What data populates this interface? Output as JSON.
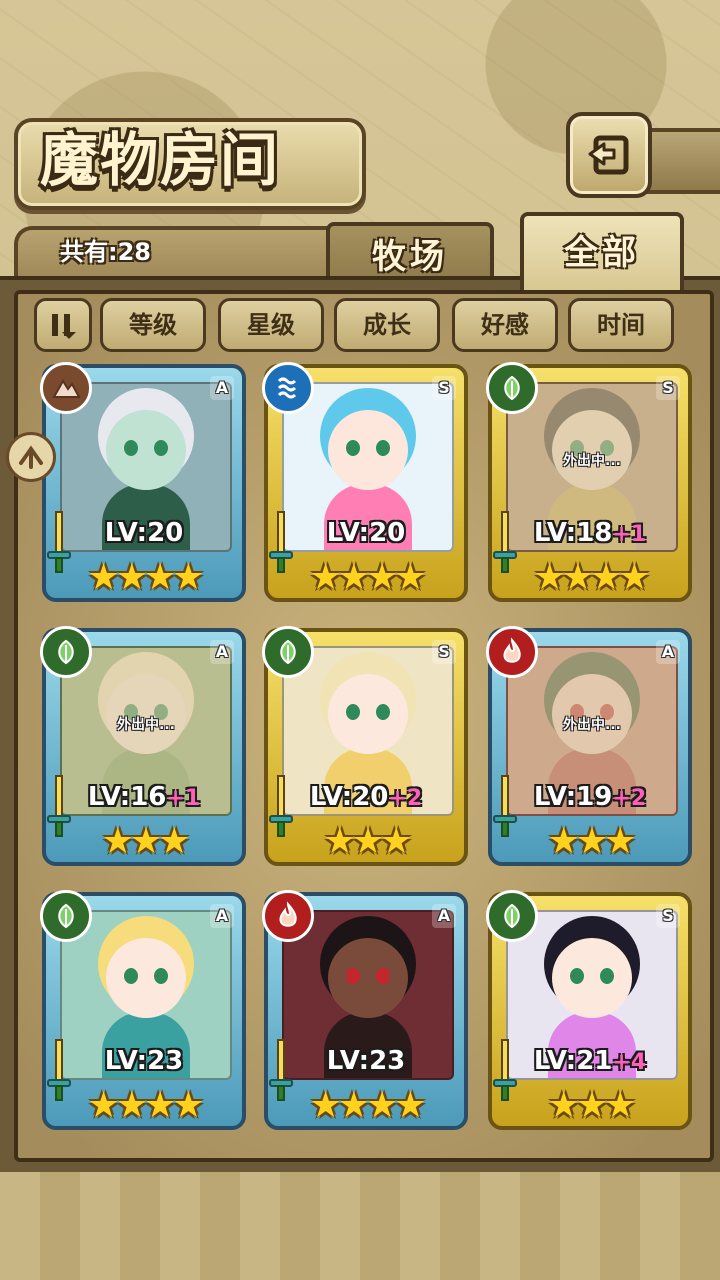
{
  "header": {
    "title": "魔物房间",
    "count_label": "共有:28"
  },
  "tabs": [
    {
      "label": "牧场",
      "active": false
    },
    {
      "label": "全部",
      "active": true
    }
  ],
  "sort": {
    "buttons": [
      "等级",
      "星级",
      "成长",
      "好感",
      "时间"
    ]
  },
  "cards": [
    {
      "rank": "A",
      "element": "earth",
      "level": "LV:20",
      "bonus": "",
      "stars": "★★★★",
      "away": "",
      "colors": {
        "hair": "#e7e9ee",
        "skin": "#bfe2d3",
        "body": "#2d5e49",
        "bg": "#8fb1b7"
      }
    },
    {
      "rank": "S",
      "element": "water",
      "level": "LV:20",
      "bonus": "",
      "stars": "★★★★",
      "away": "",
      "colors": {
        "hair": "#5fc9ec",
        "skin": "#fde6dc",
        "body": "#ff7fb5",
        "bg": "#e9f3fa"
      }
    },
    {
      "rank": "S",
      "element": "nature",
      "level": "LV:18",
      "bonus": "+1",
      "stars": "★★★★",
      "away": "外出中...",
      "colors": {
        "hair": "#3b2a2a",
        "skin": "#f3d9c7",
        "body": "#c9a24b",
        "bg": "#b58c6e"
      }
    },
    {
      "rank": "A",
      "element": "nature",
      "level": "LV:16",
      "bonus": "+1",
      "stars": "★★★",
      "away": "外出中...",
      "colors": {
        "hair": "#f7e6c9",
        "skin": "#fde8de",
        "body": "#6b9b5a",
        "bg": "#8fae7c"
      }
    },
    {
      "rank": "S",
      "element": "nature",
      "level": "LV:20",
      "bonus": "+2",
      "stars": "★★★",
      "away": "",
      "colors": {
        "hair": "#f2e3b4",
        "skin": "#fde8de",
        "body": "#f0cf6c",
        "bg": "#efe4c3"
      }
    },
    {
      "rank": "A",
      "element": "fire",
      "level": "LV:19",
      "bonus": "+2",
      "stars": "★★★",
      "away": "外出中...",
      "colors": {
        "hair": "#3c4a30",
        "skin": "#f5c9c0",
        "body": "#b23a3a",
        "bg": "#c47a6e"
      }
    },
    {
      "rank": "A",
      "element": "nature",
      "level": "LV:23",
      "bonus": "",
      "stars": "★★★★",
      "away": "",
      "colors": {
        "hair": "#f6dc7a",
        "skin": "#fde8de",
        "body": "#3aa0a0",
        "bg": "#9fd1c3"
      }
    },
    {
      "rank": "A",
      "element": "fire",
      "level": "LV:23",
      "bonus": "",
      "stars": "★★★★",
      "away": "",
      "colors": {
        "hair": "#1c1416",
        "skin": "#7a4a3a",
        "body": "#2a1a1a",
        "bg": "#6e2e34"
      }
    },
    {
      "rank": "S",
      "element": "nature",
      "level": "LV:21",
      "bonus": "+4",
      "stars": "★★★",
      "away": "",
      "colors": {
        "hair": "#1e1c2a",
        "skin": "#fde8de",
        "body": "#e086e8",
        "bg": "#e8e4f0"
      }
    }
  ]
}
